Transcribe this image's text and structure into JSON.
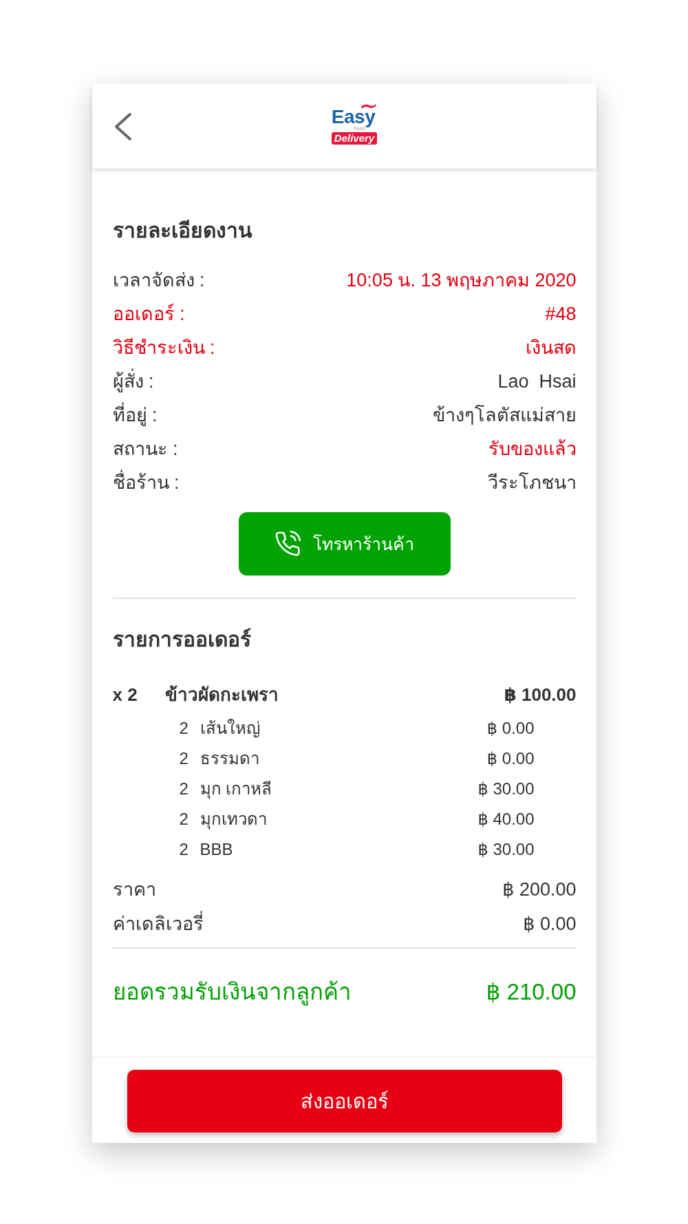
{
  "header": {
    "logo": {
      "wordmark": "Easy",
      "tagline": "Food",
      "badge": "Delivery"
    }
  },
  "job_details": {
    "title": "รายละเอียดงาน",
    "rows": [
      {
        "label": "เวลาจัดส่ง :",
        "value": "10:05 น. 13 พฤษภาคม 2020",
        "label_highlighted": false,
        "value_highlighted": true
      },
      {
        "label": "ออเดอร์ :",
        "value": "#48",
        "label_highlighted": true,
        "value_highlighted": true
      },
      {
        "label": "วิธีชำระเงิน :",
        "value": "เงินสด",
        "label_highlighted": true,
        "value_highlighted": true
      },
      {
        "label": "ผู้สั่ง :",
        "value": "Lao  Hsai",
        "label_highlighted": false,
        "value_highlighted": false
      },
      {
        "label": "ที่อยู่ :",
        "value": "ข้างๆโลตัสแม่สาย",
        "label_highlighted": false,
        "value_highlighted": false
      },
      {
        "label": "สถานะ :",
        "value": "รับของแล้ว",
        "label_highlighted": false,
        "value_highlighted": true
      },
      {
        "label": "ชื่อร้าน :",
        "value": "วีระโภชนา",
        "label_highlighted": false,
        "value_highlighted": false
      }
    ],
    "call_button": "โทรหาร้านค้า"
  },
  "order": {
    "title": "รายการออเดอร์",
    "items": [
      {
        "quantity": "x 2",
        "name": "ข้าวผัดกะเพรา",
        "price": "฿ 100.00",
        "options": [
          {
            "quantity": "2",
            "name": "เส้นใหญ่",
            "price": "฿ 0.00"
          },
          {
            "quantity": "2",
            "name": "ธรรมดา",
            "price": "฿ 0.00"
          },
          {
            "quantity": "2",
            "name": "มุก เกาหลี",
            "price": "฿ 30.00"
          },
          {
            "quantity": "2",
            "name": "มุกเทวดา",
            "price": "฿ 40.00"
          },
          {
            "quantity": "2",
            "name": "BBB",
            "price": "฿ 30.00"
          }
        ]
      }
    ],
    "charges": [
      {
        "label": "ราคา",
        "value": "฿ 200.00"
      },
      {
        "label": "ค่าเดลิเวอรี่",
        "value": "฿ 0.00"
      }
    ],
    "total": {
      "label": "ยอดรวมรับเงินจากลูกค้า",
      "value": "฿ 210.00"
    }
  },
  "footer": {
    "submit_button": "ส่งออเดอร์"
  }
}
